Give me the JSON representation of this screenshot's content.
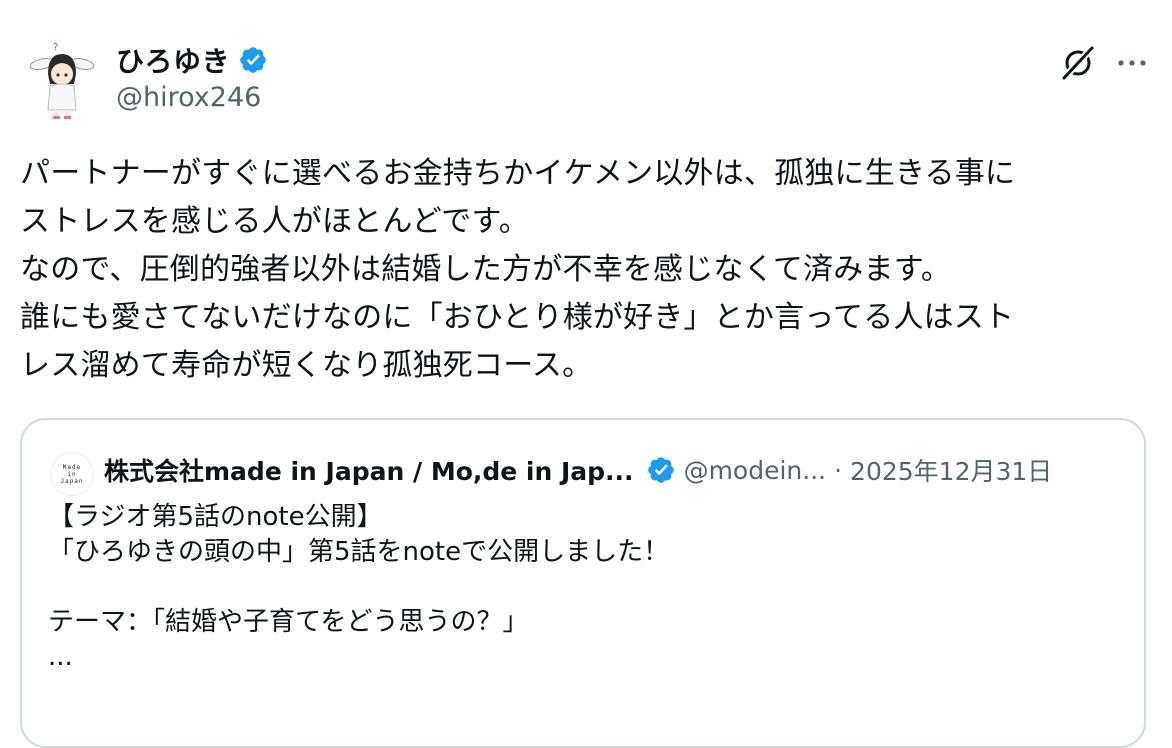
{
  "author": {
    "display_name": "ひろゆき",
    "handle": "@hirox246",
    "verified": true,
    "avatar_icon": "anime-character-avatar"
  },
  "actions": {
    "grok_icon": "grok-icon",
    "more_icon": "more-options-icon",
    "more_label": "···"
  },
  "post": {
    "text": "パートナーがすぐに選べるお金持ちかイケメン以外は、孤独に生きる事に\nストレスを感じる人がほとんどです。\nなので、圧倒的強者以外は結婚した方が不幸を感じなくて済みます。\n誰にも愛さてないだけなのに「おひとり様が好き」とか言ってる人はスト\nレス溜めて寿命が短くなり孤独死コース。"
  },
  "quote": {
    "avatar_text": [
      "Made",
      "in",
      "Japan"
    ],
    "name": "株式会社made in Japan / Mo,de in Jap...",
    "verified": true,
    "handle": "@modein...",
    "separator": "·",
    "date": "2025年12月31日",
    "text": "【ラジオ第5話のnote公開】\n「ひろゆきの頭の中」第5話をnoteで公開しました！\n\nテーマ：「結婚や子育てをどう思うの？」\n..."
  },
  "colors": {
    "text_primary": "#0f1419",
    "text_secondary": "#536471",
    "verified_blue": "#1d9bf0",
    "border": "#cfd9de"
  }
}
